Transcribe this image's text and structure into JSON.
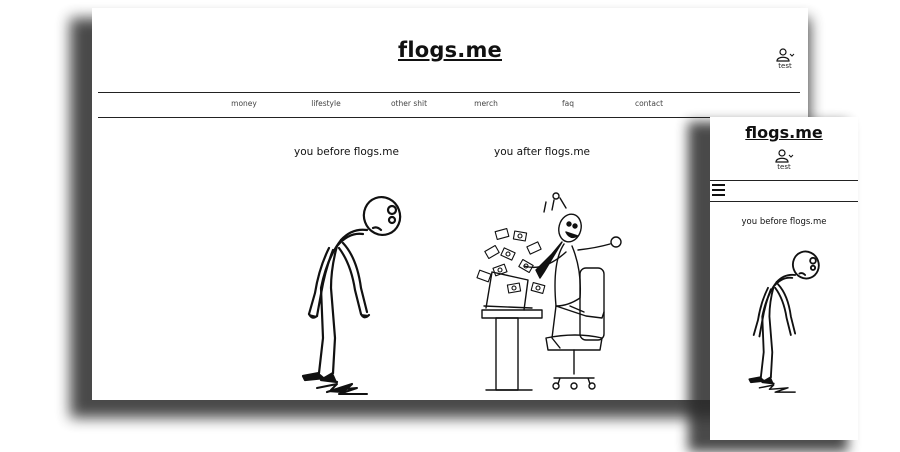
{
  "site": {
    "logo": "flogs.me"
  },
  "account": {
    "username": "test",
    "icon": "user-icon",
    "caret": "chevron-down-icon"
  },
  "nav": {
    "items": [
      "money",
      "lifestyle",
      "other shit",
      "merch",
      "faq",
      "contact"
    ]
  },
  "main": {
    "caption_before": "you before flogs.me",
    "caption_after": "you after flogs.me"
  },
  "mobile": {
    "menu_icon": "hamburger-menu-icon",
    "caption_before": "you before flogs.me"
  }
}
